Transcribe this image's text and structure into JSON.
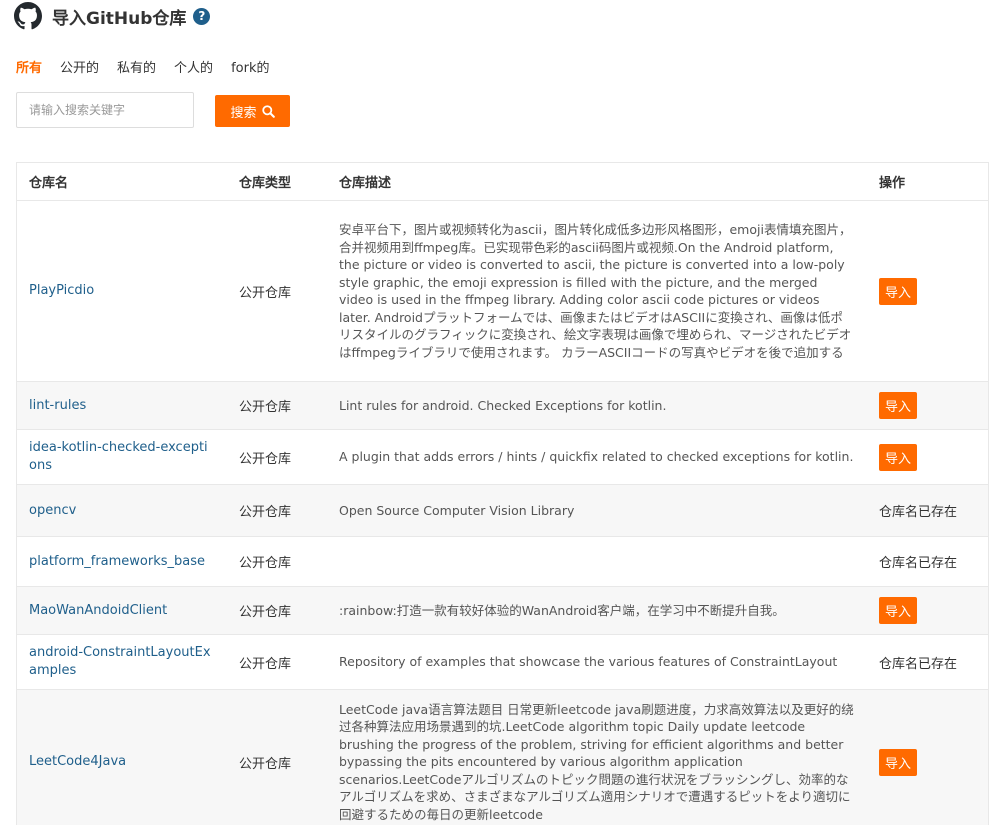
{
  "header": {
    "title": "导入GitHub仓库",
    "help_icon": "question-circle-icon",
    "logo_icon": "github-icon"
  },
  "filters": [
    {
      "label": "所有",
      "active": true
    },
    {
      "label": "公开的",
      "active": false
    },
    {
      "label": "私有的",
      "active": false
    },
    {
      "label": "个人的",
      "active": false
    },
    {
      "label": "fork的",
      "active": false
    }
  ],
  "search": {
    "placeholder": "请输入搜索关键字",
    "value": "",
    "button_label": "搜索"
  },
  "colors": {
    "accent": "#ff6a00",
    "link": "#1f5f8b"
  },
  "table": {
    "headers": {
      "name": "仓库名",
      "type": "仓库类型",
      "desc": "仓库描述",
      "action": "操作"
    },
    "rows": [
      {
        "name": "PlayPicdio",
        "type": "公开仓库",
        "desc": "安卓平台下，图片或视频转化为ascii，图片转化成低多边形风格图形，emoji表情填充图片，合并视频用到ffmpeg库。已实现带色彩的ascii码图片或视频.On the Android platform, the picture or video is converted to ascii, the picture is converted into a low-poly style graphic, the emoji expression is filled with the picture, and the merged video is used in the ffmpeg library. Adding color ascii code pictures or videos later. Androidプラットフォームでは、画像またはビデオはASCIIに変換され、画像は低ポリスタイルのグラフィックに変換され、絵文字表現は画像で埋められ、マージされたビデオはffmpegライブラリで使用されます。 カラーASCIIコードの写真やビデオを後で追加する",
        "action": "导入",
        "importable": true
      },
      {
        "name": "lint-rules",
        "type": "公开仓库",
        "desc": "Lint rules for android. Checked Exceptions for kotlin.",
        "action": "导入",
        "importable": true
      },
      {
        "name": "idea-kotlin-checked-exceptions",
        "type": "公开仓库",
        "desc": "A plugin that adds errors / hints / quickfix related to checked exceptions for kotlin.",
        "action": "导入",
        "importable": true
      },
      {
        "name": "opencv",
        "type": "公开仓库",
        "desc": "Open Source Computer Vision Library",
        "action": "仓库名已存在",
        "importable": false
      },
      {
        "name": "platform_frameworks_base",
        "type": "公开仓库",
        "desc": "",
        "action": "仓库名已存在",
        "importable": false
      },
      {
        "name": "MaoWanAndoidClient",
        "type": "公开仓库",
        "desc": ":rainbow:打造一款有较好体验的WanAndroid客户端，在学习中不断提升自我。",
        "action": "导入",
        "importable": true
      },
      {
        "name": "android-ConstraintLayoutExamples",
        "type": "公开仓库",
        "desc": "Repository of examples that showcase the various features of ConstraintLayout",
        "action": "仓库名已存在",
        "importable": false
      },
      {
        "name": "LeetCode4Java",
        "type": "公开仓库",
        "desc": "LeetCode java语言算法题目 日常更新leetcode java刷题进度，力求高效算法以及更好的绕过各种算法应用场景遇到的坑.LeetCode algorithm topic Daily update leetcode brushing the progress of the problem, striving for efficient algorithms and better bypassing the pits encountered by various algorithm application scenarios.LeetCodeアルゴリズムのトピック問題の進行状況をブラッシングし、効率的なアルゴリズムを求め、さまざまなアルゴリズム適用シナリオで遭遇するピットをより適切に回避するための毎日の更新leetcode",
        "action": "导入",
        "importable": true
      }
    ]
  }
}
